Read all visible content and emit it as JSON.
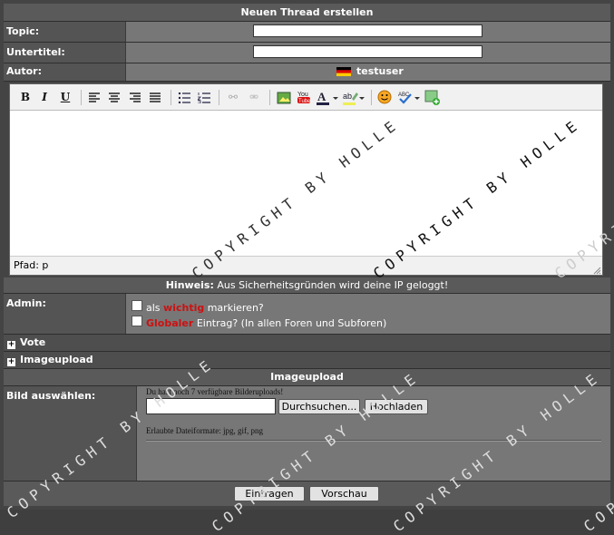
{
  "title": "Neuen Thread erstellen",
  "fields": {
    "topic_label": "Topic:",
    "subtitle_label": "Untertitel:",
    "author_label": "Autor:",
    "author_name": "testuser"
  },
  "editor": {
    "path_label": "Pfad: p",
    "watermark": "COPYRIGHT BY HOLLE"
  },
  "notice": {
    "label": "Hinweis:",
    "text": "Aus Sicherheitsgründen wird deine IP geloggt!"
  },
  "admin": {
    "label": "Admin:",
    "opt1_pre": "als",
    "opt1_em": "wichtig",
    "opt1_post": "markieren?",
    "opt2_em": "Globaler",
    "opt2_post": "Eintrag? (In allen Foren und Subforen)"
  },
  "sections": {
    "vote": "Vote",
    "imageupload": "Imageupload",
    "imageupload_header": "Imageupload"
  },
  "upload": {
    "label": "Bild auswählen:",
    "remaining": "Du hast noch 7 verfügbare Bilderuploads!",
    "browse": "Durchsuchen...",
    "upload": "Hochladen",
    "formats": "Erlaubte Dateiformate: jpg, gif, png"
  },
  "buttons": {
    "submit": "Eintragen",
    "preview": "Vorschau"
  },
  "colors": {
    "accent_red": "#cc1111"
  }
}
